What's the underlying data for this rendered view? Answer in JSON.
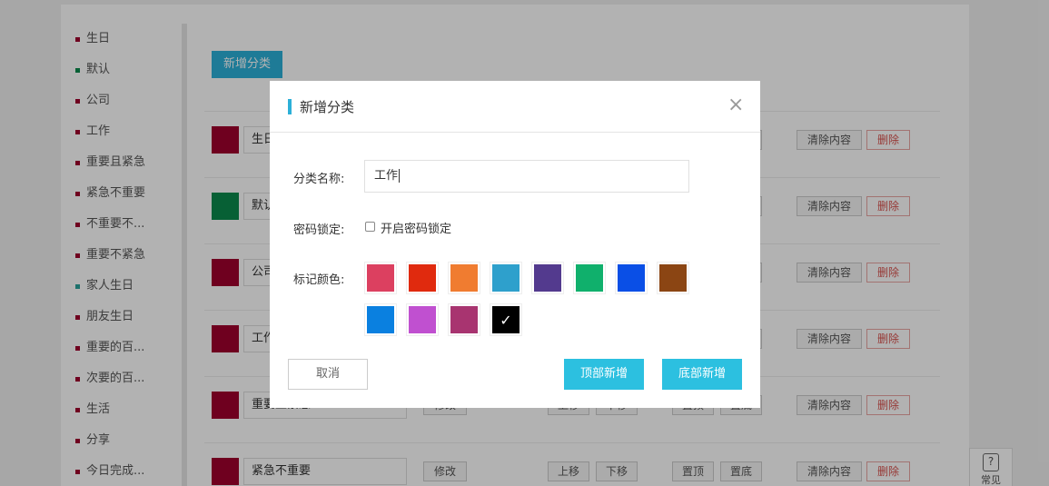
{
  "sidebar": {
    "items": [
      {
        "label": "生日",
        "color": "#a0002d"
      },
      {
        "label": "默认",
        "color": "#0b8a4c"
      },
      {
        "label": "公司",
        "color": "#a0002d"
      },
      {
        "label": "工作",
        "color": "#a0002d"
      },
      {
        "label": "重要且紧急",
        "color": "#a0002d"
      },
      {
        "label": "紧急不重要",
        "color": "#a0002d"
      },
      {
        "label": "不重要不...",
        "color": "#a0002d"
      },
      {
        "label": "重要不紧急",
        "color": "#a0002d"
      },
      {
        "label": "家人生日",
        "color": "#2aa39b"
      },
      {
        "label": "朋友生日",
        "color": "#a0002d"
      },
      {
        "label": "重要的百...",
        "color": "#a0002d"
      },
      {
        "label": "次要的百...",
        "color": "#a0002d"
      },
      {
        "label": "生活",
        "color": "#a0002d"
      },
      {
        "label": "分享",
        "color": "#a0002d"
      },
      {
        "label": "今日完成...",
        "color": "#a0002d"
      }
    ]
  },
  "toolbar": {
    "add_category_label": "新增分类"
  },
  "category_rows": [
    {
      "name": "生日",
      "color": "#a0002d"
    },
    {
      "name": "默认",
      "color": "#0b8a4c"
    },
    {
      "name": "公司",
      "color": "#a0002d"
    },
    {
      "name": "工作",
      "color": "#a0002d"
    },
    {
      "name": "重要且紧急",
      "color": "#a0002d"
    },
    {
      "name": "紧急不重要",
      "color": "#a0002d"
    }
  ],
  "row_actions": {
    "edit": "修改",
    "up": "上移",
    "down": "下移",
    "top": "置顶",
    "bottom": "置底",
    "clear": "清除内容",
    "delete": "删除"
  },
  "help": {
    "icon_glyph": "?",
    "label": "常见"
  },
  "modal": {
    "title": "新增分类",
    "close_glyph": "×",
    "name_label": "分类名称:",
    "name_value": "工作",
    "lock_label": "密码锁定:",
    "lock_checkbox_label": "开启密码锁定",
    "color_label": "标记颜色:",
    "colors": [
      "#dc4060",
      "#e02a0e",
      "#f07c30",
      "#2ea0cc",
      "#533a8e",
      "#10b06c",
      "#0a4fe6",
      "#8b4513",
      "#0a80e0",
      "#c050d0",
      "#a83470",
      "#000000"
    ],
    "selected_color_index": 11,
    "check_glyph": "✓",
    "cancel_label": "取消",
    "add_top_label": "顶部新增",
    "add_bottom_label": "底部新增"
  }
}
